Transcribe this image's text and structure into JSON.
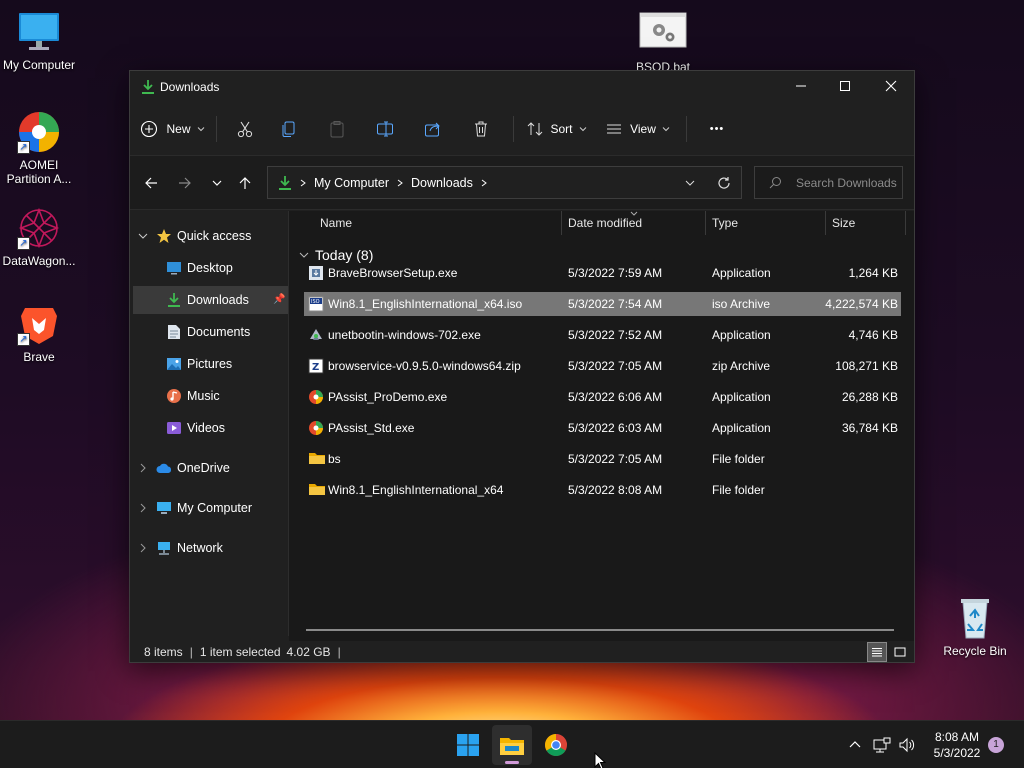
{
  "desktop": {
    "icons": [
      {
        "label": "My Computer"
      },
      {
        "label": "AOMEI Partition A..."
      },
      {
        "label": "DataWagon..."
      },
      {
        "label": "Brave"
      },
      {
        "label": "BSOD.bat"
      },
      {
        "label": "Recycle Bin"
      }
    ]
  },
  "window": {
    "title": "Downloads",
    "toolbar": {
      "new_label": "New",
      "sort_label": "Sort",
      "view_label": "View",
      "more_label": "•••"
    },
    "address": {
      "segments": [
        "My Computer",
        "Downloads"
      ],
      "search_placeholder": "Search Downloads"
    },
    "sidebar": {
      "quick_access": "Quick access",
      "items": [
        {
          "label": "Desktop",
          "icon": "desktop-icon",
          "pinned": true
        },
        {
          "label": "Downloads",
          "icon": "downloads-icon",
          "pinned": true
        },
        {
          "label": "Documents",
          "icon": "documents-icon",
          "pinned": true
        },
        {
          "label": "Pictures",
          "icon": "pictures-icon",
          "pinned": true
        },
        {
          "label": "Music",
          "icon": "music-icon",
          "pinned": false
        },
        {
          "label": "Videos",
          "icon": "videos-icon",
          "pinned": false
        }
      ],
      "onedrive": "OneDrive",
      "my_computer": "My Computer",
      "network": "Network"
    },
    "columns": {
      "name": "Name",
      "date": "Date modified",
      "type": "Type",
      "size": "Size"
    },
    "group_label": "Today (8)",
    "files": [
      {
        "name": "BraveBrowserSetup.exe",
        "date": "5/3/2022 7:59 AM",
        "type": "Application",
        "size": "1,264 KB",
        "icon": "installer-icon"
      },
      {
        "name": "Win8.1_EnglishInternational_x64.iso",
        "date": "5/3/2022 7:54 AM",
        "type": "iso Archive",
        "size": "4,222,574 KB",
        "icon": "iso-icon"
      },
      {
        "name": "unetbootin-windows-702.exe",
        "date": "5/3/2022 7:52 AM",
        "type": "Application",
        "size": "4,746 KB",
        "icon": "unetbootin-icon"
      },
      {
        "name": "browservice-v0.9.5.0-windows64.zip",
        "date": "5/3/2022 7:05 AM",
        "type": "zip Archive",
        "size": "108,271 KB",
        "icon": "zip-icon"
      },
      {
        "name": "PAssist_ProDemo.exe",
        "date": "5/3/2022 6:06 AM",
        "type": "Application",
        "size": "26,288 KB",
        "icon": "passist-icon"
      },
      {
        "name": "PAssist_Std.exe",
        "date": "5/3/2022 6:03 AM",
        "type": "Application",
        "size": "36,784 KB",
        "icon": "passist-icon"
      },
      {
        "name": "bs",
        "date": "5/3/2022 7:05 AM",
        "type": "File folder",
        "size": "",
        "icon": "folder-icon"
      },
      {
        "name": "Win8.1_EnglishInternational_x64",
        "date": "5/3/2022 8:08 AM",
        "type": "File folder",
        "size": "",
        "icon": "folder-icon"
      }
    ],
    "selected_index": 1,
    "status": {
      "items": "8 items",
      "selected": "1 item selected",
      "size": "4.02 GB",
      "trailing_sep": "|"
    }
  },
  "taskbar": {
    "time": "8:08 AM",
    "date": "5/3/2022",
    "notification_count": "1",
    "apps": [
      "start-icon",
      "file-explorer-icon",
      "chrome-icon"
    ]
  },
  "colors": {
    "window_bg": "#202020",
    "content_bg": "#191919",
    "selected_row": "#777777",
    "accent_green": "#3fb950",
    "folder_yellow": "#f4c542",
    "taskbar_bg": "#1c1c1c"
  }
}
